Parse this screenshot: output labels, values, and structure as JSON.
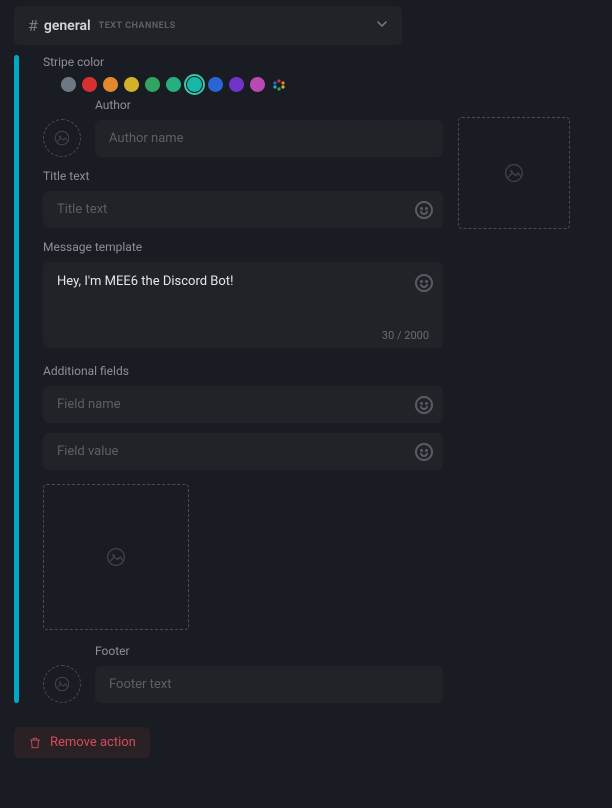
{
  "channel": {
    "hash": "#",
    "name": "general",
    "category": "TEXT CHANNELS"
  },
  "labels": {
    "stripe_color": "Stripe color",
    "author": "Author",
    "title_text": "Title text",
    "message_template": "Message template",
    "additional_fields": "Additional fields",
    "footer": "Footer"
  },
  "placeholders": {
    "author_name": "Author name",
    "title_text": "Title text",
    "field_name": "Field name",
    "field_value": "Field value",
    "footer_text": "Footer text"
  },
  "stripe_colors": [
    "#6f7882",
    "#d63031",
    "#e1892b",
    "#d3b22a",
    "#2fa561",
    "#26b07f",
    "#19b5a6",
    "#2a65d6",
    "#7234c8",
    "#b94ab3"
  ],
  "selected_color_index": 6,
  "message": {
    "value": "Hey, I'm MEE6 the Discord Bot!",
    "char_count": "30 / 2000"
  },
  "remove_label": "Remove action"
}
